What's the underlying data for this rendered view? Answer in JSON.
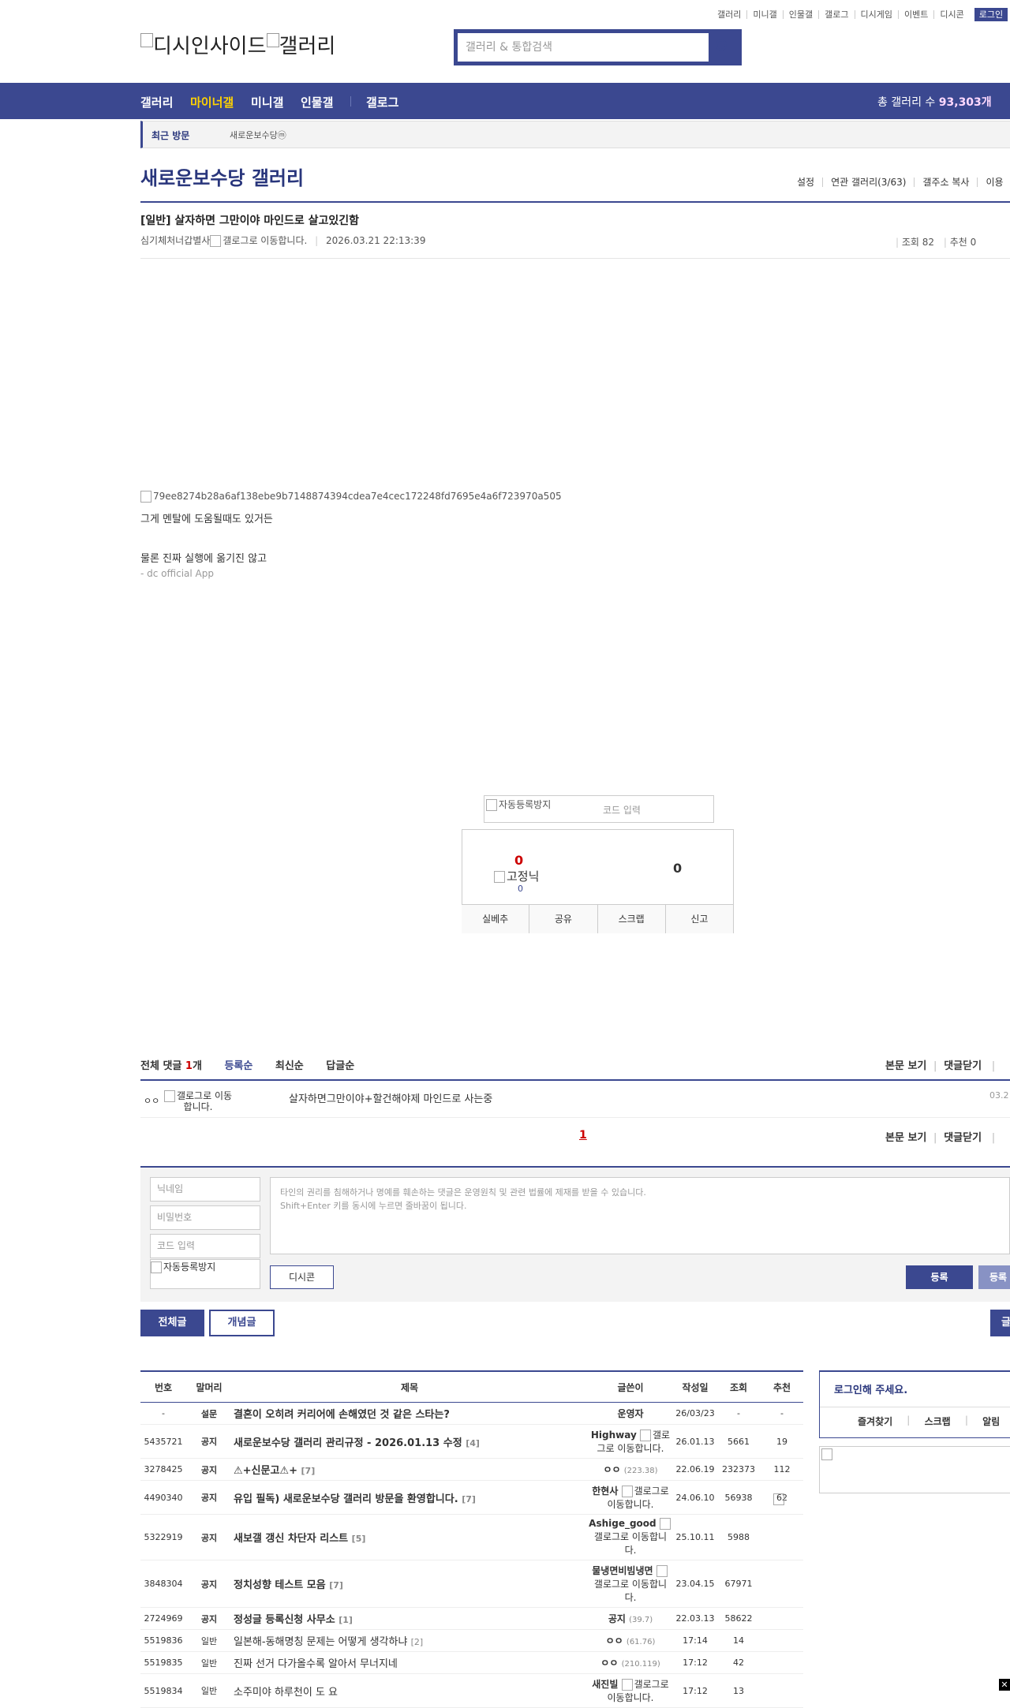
{
  "util_links": [
    "갤러리",
    "미니갤",
    "인물갤",
    "갤로그",
    "디시게임",
    "이벤트",
    "디시콘"
  ],
  "login_label": "로그인",
  "logo": {
    "text1": "디시인사이드",
    "text2": "갤러리"
  },
  "search": {
    "placeholder": "갤러리 & 통합검색"
  },
  "nav": {
    "items": [
      "갤러리",
      "마이너갤",
      "미니갤",
      "인물갤",
      "갤로그"
    ],
    "total_label": "총 갤러리 수",
    "total_value": "93,303개"
  },
  "recent": {
    "label": "최근 방문",
    "item": "새로운보수당ⓜ"
  },
  "gallery": {
    "title": "새로운보수당 갤러리",
    "menu": [
      "설정",
      "연관 갤러리(3/63)",
      "갤주소 복사",
      "이용"
    ]
  },
  "post": {
    "title": "[일반] 살자하면 그만이야 마인드로 살고있긴함",
    "author": "심기체처너갑별사",
    "author_badge_alt": "갤로그로 이동합니다.",
    "date": "2026.03.21 22:13:39",
    "views_label": "조회 82",
    "recommend_label": "추천 0",
    "image_alt": "79ee8274b28a6af138ebe9b7148874394cdea7e4cec172248fd7695e4a6f723970a505",
    "line1": "그게 멘탈에 도움될때도 있거든",
    "line2": "물론 진짜 실행에 옮기진 않고",
    "app": "- dc official App"
  },
  "captcha": {
    "img_alt": "자동등록방지",
    "placeholder": "코드 입력"
  },
  "vote": {
    "up": "0",
    "fixed_label": "고정닉",
    "fixed_count": "0",
    "down": "0",
    "buttons": [
      "실베추",
      "공유",
      "스크랩",
      "신고"
    ]
  },
  "comments": {
    "total_prefix": "전체 댓글",
    "total_count": "1",
    "total_suffix": "개",
    "sort": [
      "등록순",
      "최신순",
      "답글순"
    ],
    "view_post": "본문 보기",
    "close": "댓글닫기",
    "items": [
      {
        "author": "ㅇㅇ",
        "badge_alt": "갤로그로 이동합니다.",
        "text": "살자하면그만이야+할건해야제 마인드로 사는중",
        "date": "03.2"
      }
    ],
    "page": "1"
  },
  "form": {
    "nick": "닉네임",
    "password": "비밀번호",
    "code": "코드 입력",
    "captcha_alt": "자동등록방지",
    "placeholder_line1": "타인의 권리를 침해하거나 명예를 훼손하는 댓글은 운영원칙 및 관련 법률에 제재를 받을 수 있습니다.",
    "placeholder_line2": "Shift+Enter 키를 동시에 누르면 줄바꿈이 됩니다.",
    "dccon": "디시콘",
    "submit": "등록",
    "submit2": "등록"
  },
  "list_tabs": {
    "all": "전체글",
    "concept": "개념글",
    "write": "글"
  },
  "list": {
    "headers": [
      "번호",
      "말머리",
      "제목",
      "글쓴이",
      "작성일",
      "조회",
      "추천"
    ],
    "rows": [
      {
        "no": "-",
        "head": "설문",
        "title": "결혼이 오히려 커리어에 손해였던 것 같은 스타는?",
        "cnt": "",
        "writer": "운영자",
        "ip": "",
        "date": "26/03/23",
        "views": "-",
        "rec": "-"
      },
      {
        "no": "5435721",
        "head": "공지",
        "title": "새로운보수당 갤러리 관리규정 - 2026.01.13 수정",
        "cnt": "[4]",
        "writer": "Highway",
        "ip": "",
        "date": "26.01.13",
        "views": "5661",
        "rec": "19"
      },
      {
        "no": "3278425",
        "head": "공지",
        "title": "⚠+신문고⚠+",
        "cnt": "[7]",
        "writer": "ㅇㅇ",
        "ip": "(223.38)",
        "date": "22.06.19",
        "views": "232373",
        "rec": "112"
      },
      {
        "no": "4490340",
        "head": "공지",
        "title": "유입 필독) 새로운보수당 갤러리 방문을 환영합니다.",
        "cnt": "[7]",
        "writer": "한현사",
        "ip": "",
        "date": "24.06.10",
        "views": "56938",
        "rec": "62"
      },
      {
        "no": "5322919",
        "head": "공지",
        "title": "새보갤 갱신 차단자 리스트",
        "cnt": "[5]",
        "writer": "Ashige_good",
        "ip": "",
        "date": "25.10.11",
        "views": "5988",
        "rec": ""
      },
      {
        "no": "3848304",
        "head": "공지",
        "title": "정치성향 테스트 모음",
        "cnt": "[7]",
        "writer": "물냉면비빔냉면",
        "ip": "",
        "date": "23.04.15",
        "views": "67971",
        "rec": ""
      },
      {
        "no": "2724969",
        "head": "공지",
        "title": "정성글 등록신청 사무소",
        "cnt": "[1]",
        "writer": "공지",
        "ip": "(39.7)",
        "date": "22.03.13",
        "views": "58622",
        "rec": ""
      },
      {
        "no": "5519836",
        "head": "일반",
        "title": "일본해-동해명칭 문제는 어떻게 생각하냐",
        "cnt": "[2]",
        "writer": "ㅇㅇ",
        "ip": "(61.76)",
        "date": "17:14",
        "views": "14",
        "rec": ""
      },
      {
        "no": "5519835",
        "head": "일반",
        "title": "진짜 선거 다가올수록 알아서 무너지네",
        "cnt": "",
        "writer": "ㅇㅇ",
        "ip": "(210.119)",
        "date": "17:12",
        "views": "42",
        "rec": ""
      },
      {
        "no": "5519834",
        "head": "일반",
        "title": "소주미야 하루천이 도 요",
        "cnt": "",
        "writer": "새진빌",
        "ip": "",
        "date": "17:12",
        "views": "13",
        "rec": ""
      }
    ],
    "badge_alt": "갤로그로 이동합니다."
  },
  "side": {
    "login_msg": "로그인해 주세요.",
    "links": [
      "즐겨찾기",
      "스크랩",
      "알림"
    ]
  }
}
